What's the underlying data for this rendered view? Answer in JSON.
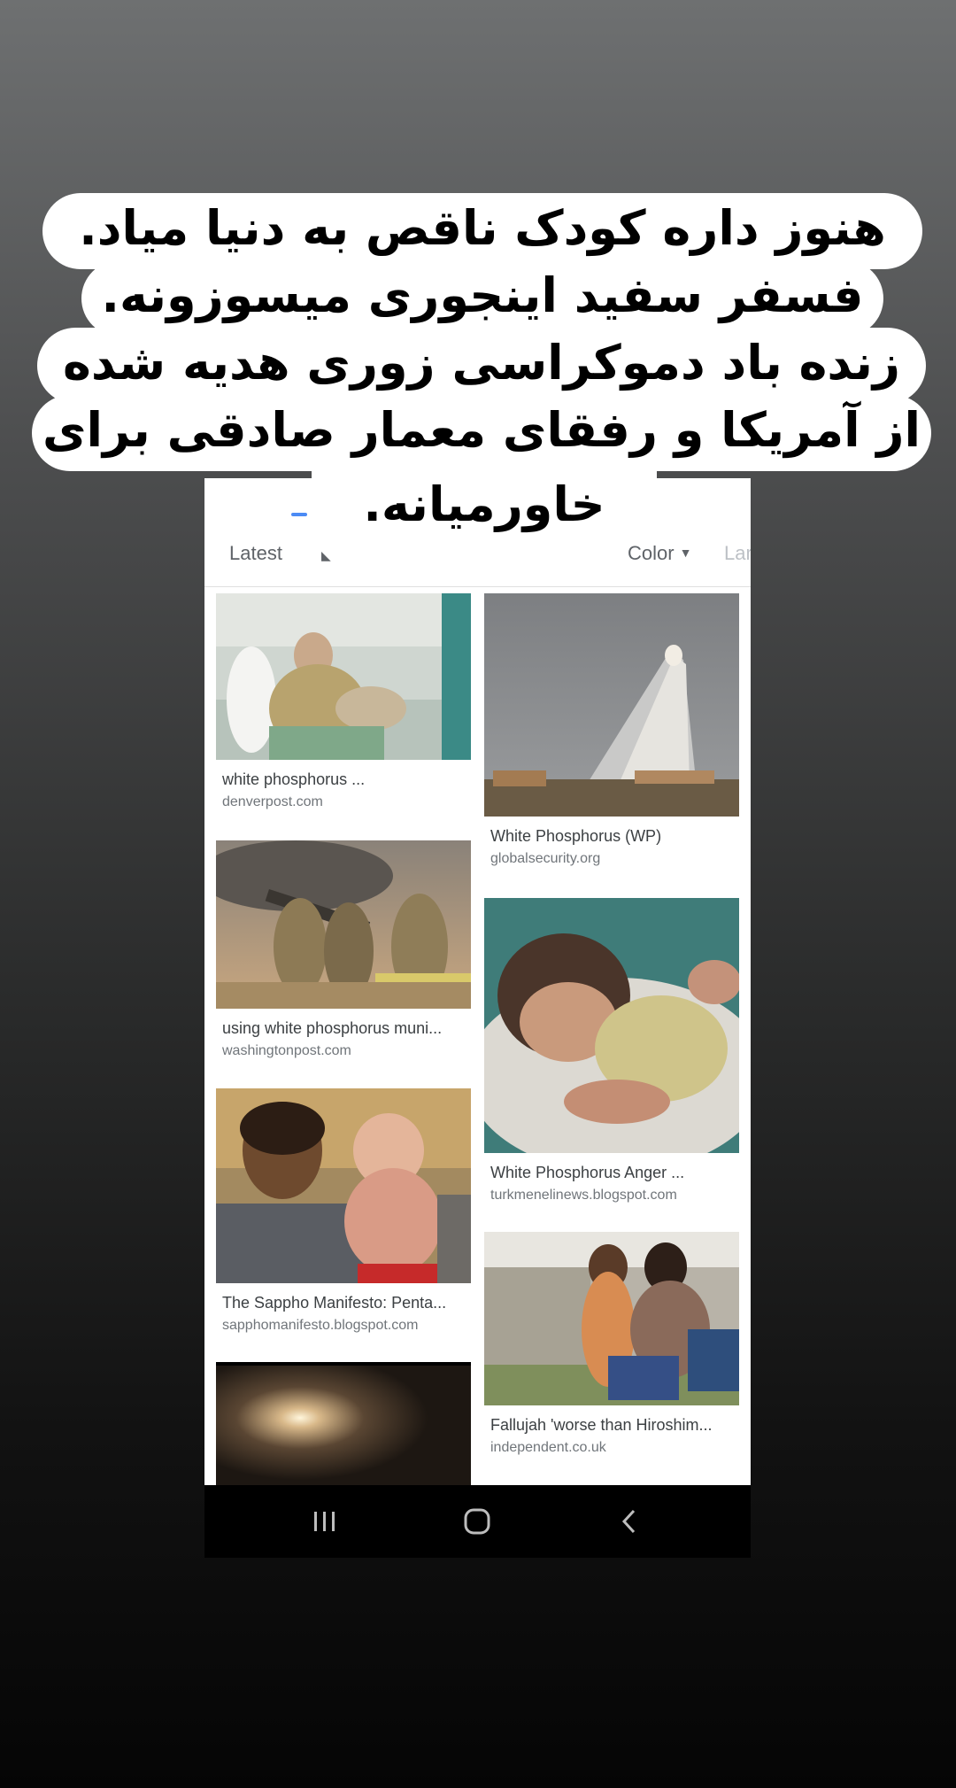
{
  "caption": {
    "lines": [
      "هنوز داره کودک ناقص به دنیا میاد.",
      "فسفر سفید اینجوری میسوزونه.",
      "زنده باد دموکراسی زوری هدیه شده",
      "از آمریکا و رفقای معمار صادقی برای",
      "خاورمیانه."
    ]
  },
  "filters": {
    "latest": "Latest",
    "color": "Color",
    "large": "Large",
    "active_tab_color": "#4c8bf5"
  },
  "results": {
    "left": [
      {
        "title": "white phosphorus ...",
        "source": "denverpost.com",
        "image": "burn-victim-hospital"
      },
      {
        "title": "using white phosphorus muni...",
        "source": "washingtonpost.com",
        "image": "soldiers-artillery"
      },
      {
        "title": "The Sappho Manifesto: Penta...",
        "source": "sapphomanifesto.blogspot.com",
        "image": "father-burned-child"
      },
      {
        "title": "",
        "source": "",
        "image": "night-flare"
      }
    ],
    "right": [
      {
        "title": "White Phosphorus (WP)",
        "source": "globalsecurity.org",
        "image": "smoke-plume-over-town"
      },
      {
        "title": "White Phosphorus Anger ...",
        "source": "turkmenelinews.blogspot.com",
        "image": "sleeping-infant"
      },
      {
        "title": "Fallujah 'worse than Hiroshim...",
        "source": "independent.co.uk",
        "image": "boy-in-wheelchair"
      }
    ]
  },
  "navbar": {
    "recents": "recents-icon",
    "home": "home-icon",
    "back": "back-icon"
  }
}
